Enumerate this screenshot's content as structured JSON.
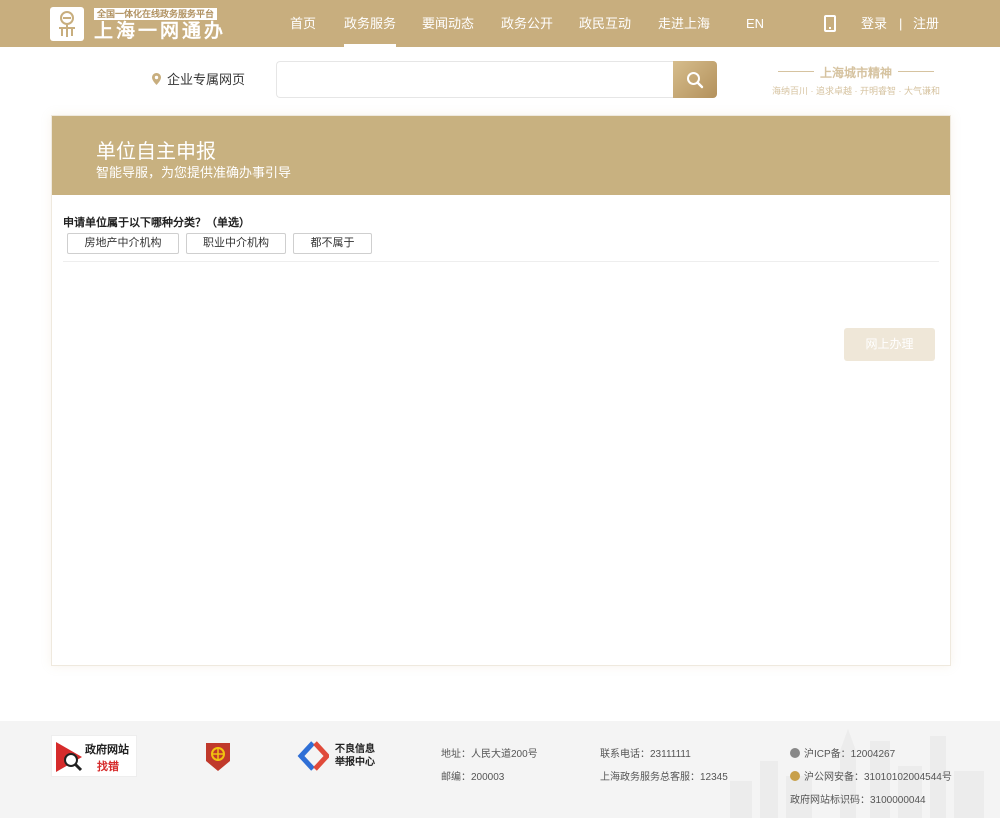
{
  "header": {
    "logo_subtitle": "全国一体化在线政务服务平台",
    "logo_title": "上海一网通办",
    "nav": [
      {
        "label": "首页"
      },
      {
        "label": "政务服务"
      },
      {
        "label": "要闻动态"
      },
      {
        "label": "政务公开"
      },
      {
        "label": "政民互动"
      },
      {
        "label": "走进上海"
      },
      {
        "label": "EN"
      }
    ],
    "active_nav": "政务服务",
    "login_label": "登录",
    "separator": "|",
    "register_label": "注册"
  },
  "search": {
    "location_label": "企业专属网页",
    "value": "",
    "placeholder": ""
  },
  "spirit": {
    "title": "上海城市精神",
    "subtitle": "海纳百川 · 追求卓越 · 开明睿智 · 大气谦和"
  },
  "card": {
    "banner_title": "单位自主申报",
    "banner_subtitle": "智能导服，为您提供准确办事引导",
    "question": "申请单位属于以下哪种分类？（单选）",
    "options": [
      {
        "label": "房地产中介机构"
      },
      {
        "label": "职业中介机构"
      },
      {
        "label": "都不属于"
      }
    ],
    "online_button": "网上办理"
  },
  "footer": {
    "gov_badge_line1": "政府网站",
    "gov_badge_line2": "找错",
    "report_line1": "不良信息",
    "report_line2": "举报中心",
    "address": "地址：人民大道200号",
    "postcode": "邮编：200003",
    "phone": "联系电话：23111111",
    "hotline": "上海政务服务总客服：12345",
    "icp": "沪ICP备：12004267",
    "police": "沪公网安备：31010102004544号",
    "site_code": "政府网站标识码：3100000044"
  },
  "colors": {
    "brand": "#c8ae7e",
    "banner": "#c8b180",
    "accent_red": "#d62b2b"
  }
}
